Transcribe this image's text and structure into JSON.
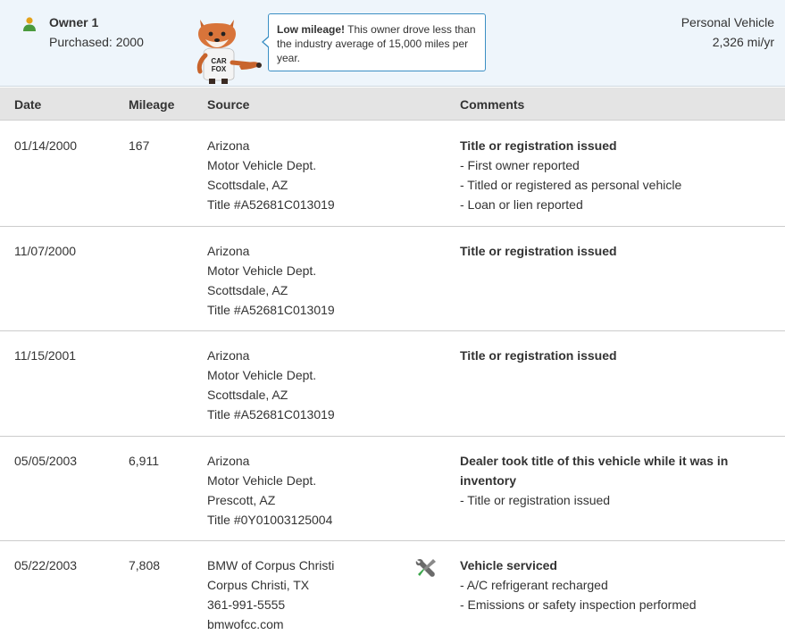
{
  "owner": {
    "name": "Owner 1",
    "purchased": "Purchased: 2000",
    "callout_bold": "Low mileage!",
    "callout_text": "This owner drove less than the industry average of 15,000 miles per year.",
    "vehicle_type": "Personal Vehicle",
    "mileage_rate": "2,326 mi/yr",
    "mascot_text_1": "CAR",
    "mascot_text_2": "FOX"
  },
  "table": {
    "headers": {
      "date": "Date",
      "mileage": "Mileage",
      "source": "Source",
      "comments": "Comments"
    },
    "rows": [
      {
        "date": "01/14/2000",
        "mileage": "167",
        "source": [
          "Arizona",
          "Motor Vehicle Dept.",
          "Scottsdale, AZ",
          "Title #A52681C013019"
        ],
        "comment_title": "Title or registration issued",
        "comment_items": [
          "- First owner reported",
          "- Titled or registered as personal vehicle",
          "- Loan or lien reported"
        ]
      },
      {
        "date": "11/07/2000",
        "mileage": "",
        "source": [
          "Arizona",
          "Motor Vehicle Dept.",
          "Scottsdale, AZ",
          "Title #A52681C013019"
        ],
        "comment_title": "Title or registration issued",
        "comment_items": []
      },
      {
        "date": "11/15/2001",
        "mileage": "",
        "source": [
          "Arizona",
          "Motor Vehicle Dept.",
          "Scottsdale, AZ",
          "Title #A52681C013019"
        ],
        "comment_title": "Title or registration issued",
        "comment_items": []
      },
      {
        "date": "05/05/2003",
        "mileage": "6,911",
        "source": [
          "Arizona",
          "Motor Vehicle Dept.",
          "Prescott, AZ",
          "Title #0Y01003125004"
        ],
        "comment_title": "Dealer took title of this vehicle while it was in inventory",
        "comment_items": [
          "- Title or registration issued"
        ]
      },
      {
        "date": "05/22/2003",
        "mileage": "7,808",
        "source": [
          "BMW of Corpus Christi",
          "Corpus Christi, TX",
          "361-991-5555",
          "bmwofcc.com"
        ],
        "comment_title": "Vehicle serviced",
        "comment_items": [
          "- A/C refrigerant recharged",
          "- Emissions or safety inspection performed"
        ],
        "icon": "service-tools-icon"
      }
    ]
  },
  "colors": {
    "header_bg": "#eef5fb",
    "table_header_bg": "#e4e4e4",
    "callout_border": "#3b8fc4",
    "owner_icon_head": "#e3a21a",
    "owner_icon_body": "#4a9a3d",
    "service_icon_wrench": "#6a6a6a",
    "service_icon_screwdriver": "#3aa54a"
  }
}
